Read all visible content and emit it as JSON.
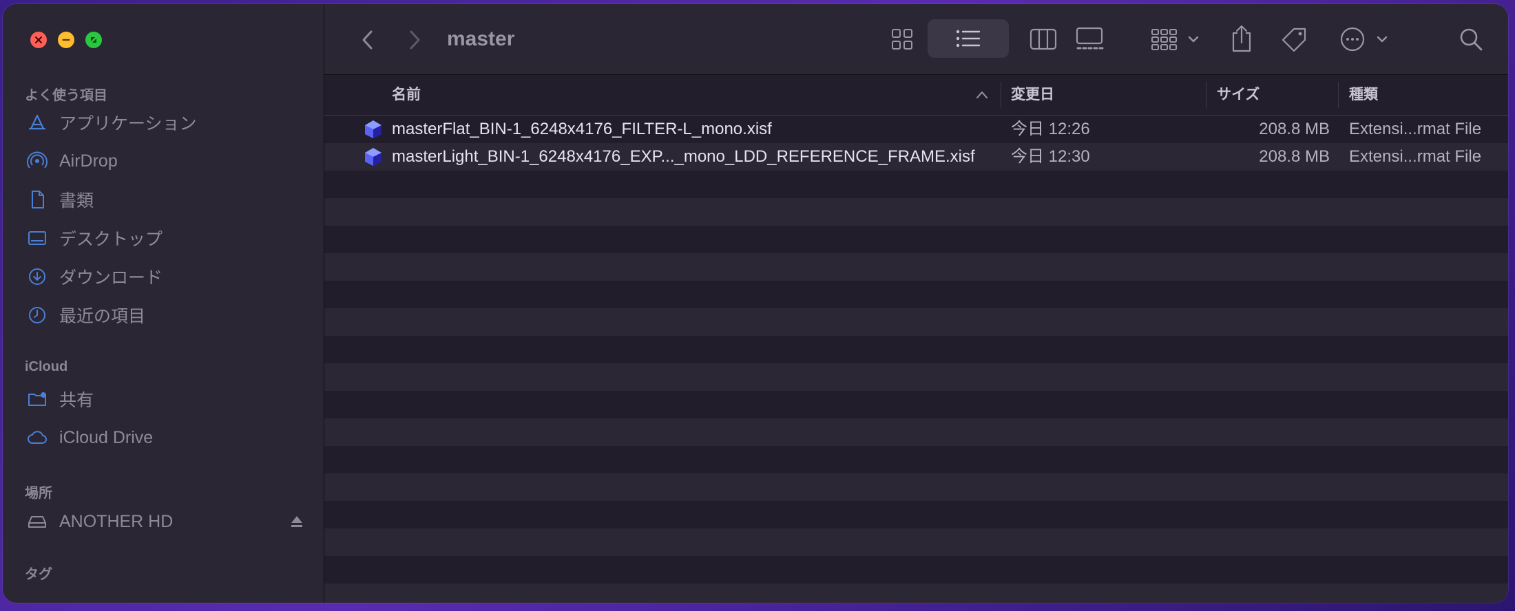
{
  "window": {
    "title": "master"
  },
  "sidebar": {
    "sections": {
      "favorites": "よく使う項目",
      "icloud": "iCloud",
      "locations": "場所",
      "tags": "タグ"
    },
    "favorites": [
      {
        "label": "アプリケーション",
        "icon": "applications-icon"
      },
      {
        "label": "AirDrop",
        "icon": "airdrop-icon"
      },
      {
        "label": "書類",
        "icon": "documents-icon"
      },
      {
        "label": "デスクトップ",
        "icon": "desktop-icon"
      },
      {
        "label": "ダウンロード",
        "icon": "downloads-icon"
      },
      {
        "label": "最近の項目",
        "icon": "recents-icon"
      }
    ],
    "icloud_items": [
      {
        "label": "共有",
        "icon": "shared-folder-icon"
      },
      {
        "label": "iCloud Drive",
        "icon": "icloud-icon"
      }
    ],
    "locations": [
      {
        "label": "ANOTHER HD",
        "icon": "disk-icon"
      }
    ]
  },
  "columns": {
    "name": "名前",
    "modified": "変更日",
    "size": "サイズ",
    "kind": "種類"
  },
  "files": [
    {
      "name": "masterFlat_BIN-1_6248x4176_FILTER-L_mono.xisf",
      "modified": "今日 12:26",
      "size": "208.8 MB",
      "kind": "Extensi...rmat File"
    },
    {
      "name": "masterLight_BIN-1_6248x4176_EXP..._mono_LDD_REFERENCE_FRAME.xisf",
      "modified": "今日 12:30",
      "size": "208.8 MB",
      "kind": "Extensi...rmat File"
    }
  ],
  "colors": {
    "sidebar_icon": "#4a7fd6",
    "window_bg": "#211d2a",
    "sidebar_bg": "#2a2633"
  }
}
